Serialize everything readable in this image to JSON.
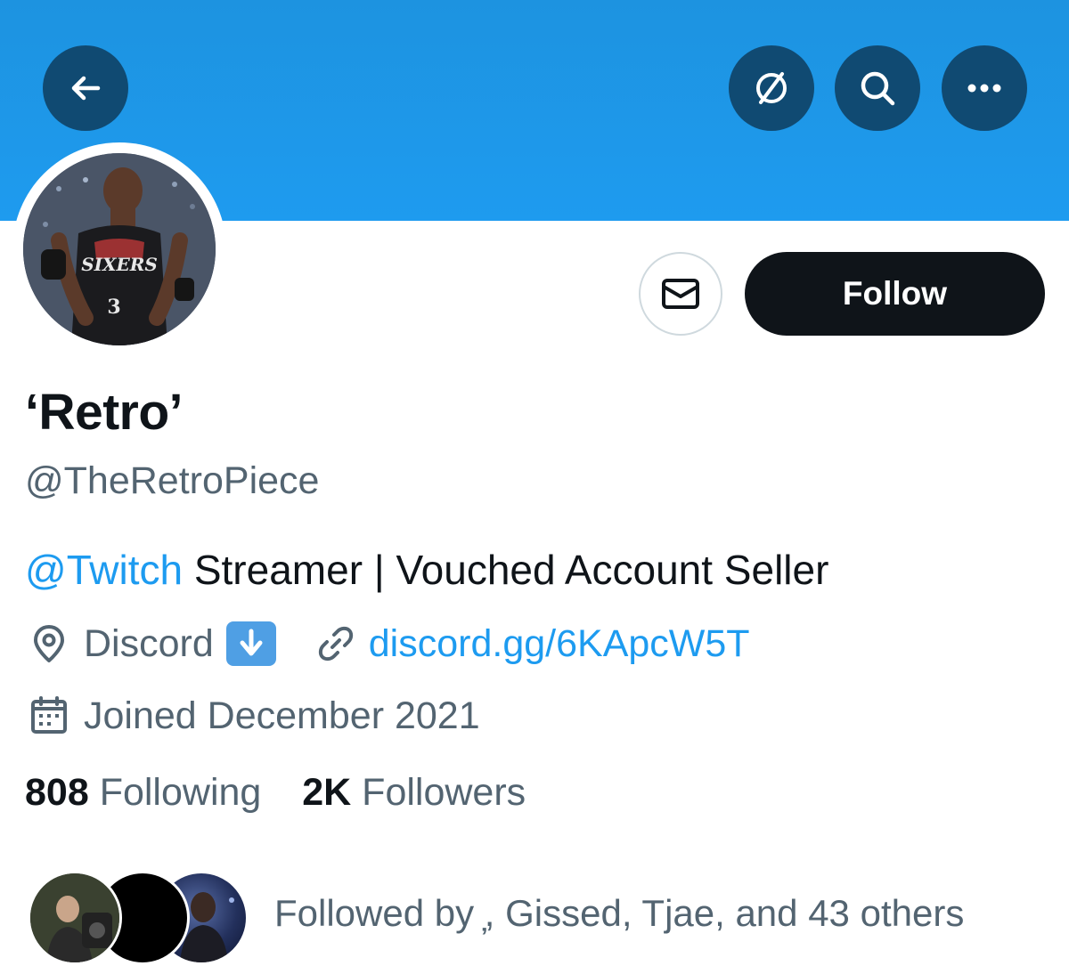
{
  "header": {
    "back_icon": "arrow-left-icon",
    "grok_icon": "grok-icon",
    "search_icon": "search-icon",
    "more_icon": "more-horizontal-icon",
    "banner_color": "#1d9bf0",
    "button_color": "#104a72"
  },
  "profile": {
    "display_name": "‘Retro’",
    "handle": "@TheRetroPiece",
    "bio_mention": "@Twitch",
    "bio_text": " Streamer | Vouched Account Seller",
    "location_icon": "location-pin-icon",
    "location": "Discord",
    "location_emoji": "down-arrow-emoji",
    "link_icon": "link-icon",
    "link": "discord.gg/6KApcW5T",
    "calendar_icon": "calendar-icon",
    "joined": "Joined December 2021",
    "following_count": "808",
    "following_label": "Following",
    "followers_count": "2K",
    "followers_label": "Followers",
    "followed_by": "Followed by ̦, Gissed, Tjae, and 43 others"
  },
  "actions": {
    "message_icon": "mail-icon",
    "follow_label": "Follow"
  },
  "colors": {
    "accent": "#1d9bf0",
    "text_primary": "#0f1419",
    "text_secondary": "#536471",
    "follow_button": "#0f1419"
  }
}
